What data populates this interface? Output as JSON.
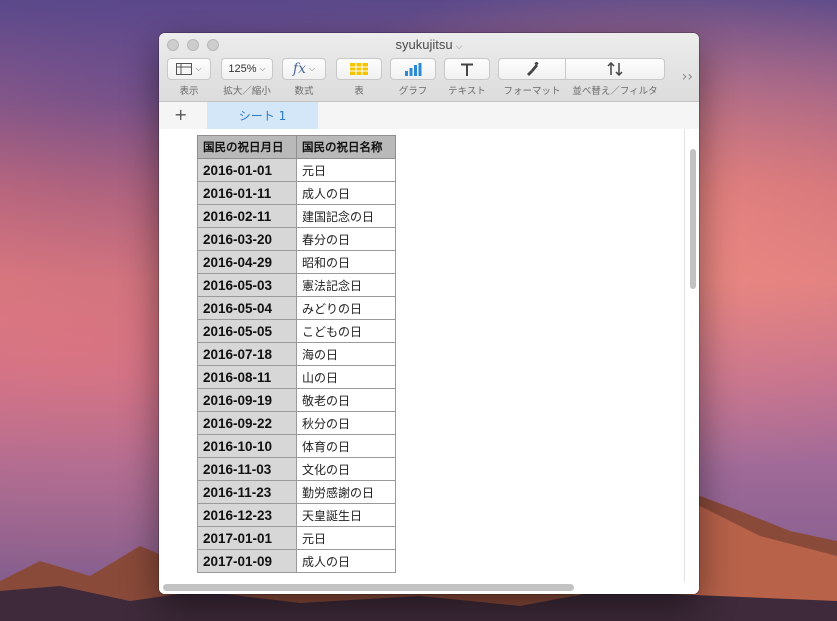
{
  "window": {
    "title": "syukujitsu"
  },
  "toolbar": {
    "view_label": "表示",
    "zoom_value": "125%",
    "zoom_label": "拡大／縮小",
    "formula_glyph": "fx",
    "formula_label": "数式",
    "table_label": "表",
    "chart_label": "グラフ",
    "text_label": "テキスト",
    "format_label": "フォーマット",
    "sort_label": "並べ替え／フィルタ",
    "more_glyph": "››"
  },
  "sheets": {
    "add_glyph": "+",
    "tabs": [
      {
        "label": "シート 1"
      }
    ]
  },
  "table": {
    "headers": [
      "国民の祝日月日",
      "国民の祝日名称"
    ],
    "rows": [
      [
        "2016-01-01",
        "元日"
      ],
      [
        "2016-01-11",
        "成人の日"
      ],
      [
        "2016-02-11",
        "建国記念の日"
      ],
      [
        "2016-03-20",
        "春分の日"
      ],
      [
        "2016-04-29",
        "昭和の日"
      ],
      [
        "2016-05-03",
        "憲法記念日"
      ],
      [
        "2016-05-04",
        "みどりの日"
      ],
      [
        "2016-05-05",
        "こどもの日"
      ],
      [
        "2016-07-18",
        "海の日"
      ],
      [
        "2016-08-11",
        "山の日"
      ],
      [
        "2016-09-19",
        "敬老の日"
      ],
      [
        "2016-09-22",
        "秋分の日"
      ],
      [
        "2016-10-10",
        "体育の日"
      ],
      [
        "2016-11-03",
        "文化の日"
      ],
      [
        "2016-11-23",
        "勤労感謝の日"
      ],
      [
        "2016-12-23",
        "天皇誕生日"
      ],
      [
        "2017-01-01",
        "元日"
      ],
      [
        "2017-01-09",
        "成人の日"
      ]
    ]
  },
  "colors": {
    "tab_bg": "#d4e7f8",
    "tab_text": "#2d7bc4",
    "chart_icon": "#2b8ad8",
    "table_icon": "#f5c400"
  }
}
